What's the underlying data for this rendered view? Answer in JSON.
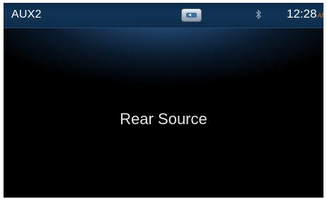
{
  "status_bar": {
    "source": "AUX2",
    "time": "12:28",
    "ampm": "AM",
    "icons": [
      "tuner-tab-icon",
      "bluetooth-icon"
    ]
  },
  "main": {
    "message": "Rear Source"
  },
  "colors": {
    "background": "#000000",
    "bar": "#103457",
    "text": "#ffffff",
    "ampm": "#e46a1e"
  }
}
